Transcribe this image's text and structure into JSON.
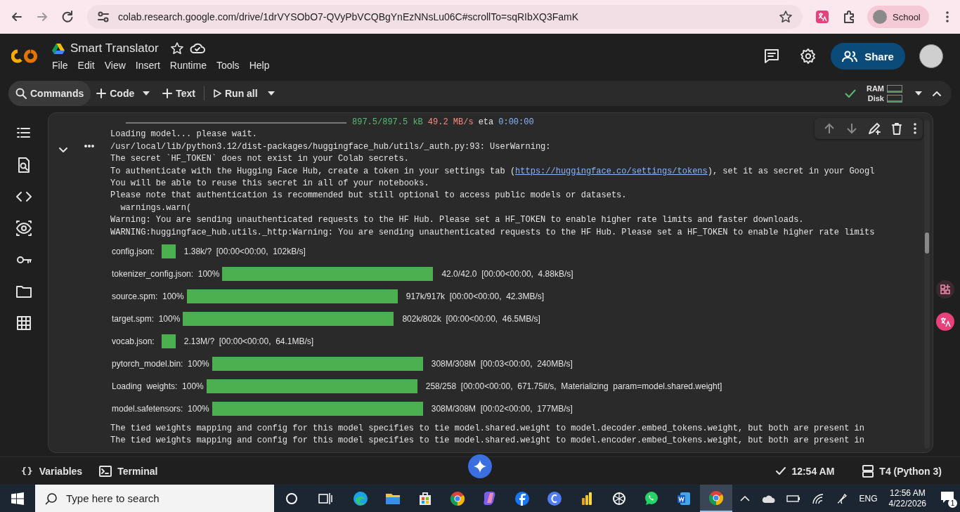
{
  "browser": {
    "url": "colab.research.google.com/drive/1drVYSObO7-QVyPbVCQBgYnEzNNsLu06C#scrollTo=sqRIbXQ3FamK",
    "profile": "School"
  },
  "notebook": {
    "title": "Smart Translator",
    "menu": [
      "File",
      "Edit",
      "View",
      "Insert",
      "Runtime",
      "Tools",
      "Help"
    ],
    "share": "Share"
  },
  "toolbar": {
    "commands": "Commands",
    "code": "Code",
    "text": "Text",
    "run_all": "Run all",
    "ram": "RAM",
    "disk": "Disk"
  },
  "output": {
    "progress_line": {
      "level": 1,
      "size": "897.5/897.5 kB",
      "speed": "49.2 MB/s",
      "eta_label": "eta",
      "eta": "0:00:00"
    },
    "lines": [
      {
        "text": "Loading model... please wait."
      },
      {
        "text": "/usr/local/lib/python3.12/dist-packages/huggingface_hub/utils/_auth.py:93: UserWarning:"
      },
      {
        "text": "The secret `HF_TOKEN` does not exist in your Colab secrets."
      },
      {
        "text": "To authenticate with the Hugging Face Hub, create a token in your settings tab (",
        "link": "https://huggingface.co/settings/tokens",
        "after": "), set it as secret in your Googl"
      },
      {
        "text": "You will be able to reuse this secret in all of your notebooks."
      },
      {
        "text": "Please note that authentication is recommended but still optional to access public models or datasets."
      },
      {
        "text": "  warnings.warn("
      },
      {
        "text": "Warning: You are sending unauthenticated requests to the HF Hub. Please set a HF_TOKEN to enable higher rate limits and faster downloads."
      },
      {
        "text": "WARNING:huggingface_hub.utils._http:Warning: You are sending unauthenticated requests to the HF Hub. Please set a HF_TOKEN to enable higher rate limits"
      }
    ],
    "bars": [
      {
        "kind": "square",
        "label": "config.json:",
        "stats": "1.38k/?  [00:00<00:00,  102kB/s]"
      },
      {
        "kind": "bar",
        "label": "tokenizer_config.json:",
        "percent": "100%",
        "level": 1,
        "stats": "42.0/42.0  [00:00<00:00,  4.88kB/s]"
      },
      {
        "kind": "bar",
        "label": "source.spm:",
        "percent": "100%",
        "level": 1,
        "stats": "917k/917k  [00:00<00:00,  42.3MB/s]"
      },
      {
        "kind": "bar",
        "label": "target.spm:",
        "percent": "100%",
        "level": 1,
        "stats": "802k/802k  [00:00<00:00,  46.5MB/s]"
      },
      {
        "kind": "square",
        "label": "vocab.json:",
        "stats": "2.13M/?  [00:00<00:00,  64.1MB/s]"
      },
      {
        "kind": "bar",
        "label": "pytorch_model.bin:",
        "percent": "100%",
        "level": 1,
        "stats": "308M/308M  [00:03<00:00,  240MB/s]"
      },
      {
        "kind": "bar",
        "label": "Loading  weights:",
        "percent": "100%",
        "level": 1,
        "stats": "258/258  [00:00<00:00,  671.75it/s,  Materializing  param=model.shared.weight]"
      },
      {
        "kind": "bar",
        "label": "model.safetensors:",
        "percent": "100%",
        "level": 1,
        "stats": "308M/308M  [00:02<00:00,  177MB/s]"
      }
    ],
    "lines_after": [
      {
        "text": "The tied weights mapping and config for this model specifies to tie model.shared.weight to model.decoder.embed_tokens.weight, but both are present in"
      },
      {
        "text": "The tied weights mapping and config for this model specifies to tie model.shared.weight to model.encoder.embed_tokens.weight, but both are present in"
      }
    ]
  },
  "status_bar": {
    "variables_icon": "{}",
    "variables": "Variables",
    "terminal": "Terminal",
    "time": "12:54 AM",
    "runtime": "T4 (Python 3)"
  },
  "taskbar": {
    "search_placeholder": "Type here to search",
    "apps": [
      {
        "kind": "edge",
        "selected": false
      },
      {
        "kind": "files",
        "selected": false
      },
      {
        "kind": "store",
        "selected": false
      },
      {
        "kind": "chrome",
        "selected": false
      },
      {
        "kind": "copilot",
        "selected": false
      },
      {
        "kind": "facebook",
        "selected": false
      },
      {
        "kind": "canva",
        "selected": false
      },
      {
        "kind": "powerbi",
        "selected": false
      },
      {
        "kind": "chatgpt",
        "selected": false
      },
      {
        "kind": "whatsapp",
        "selected": false
      },
      {
        "kind": "word",
        "selected": false
      },
      {
        "kind": "chrome",
        "selected": true
      }
    ],
    "language": "ENG",
    "time": "12:56 AM",
    "date": "4/22/2026",
    "notifications": "1"
  }
}
